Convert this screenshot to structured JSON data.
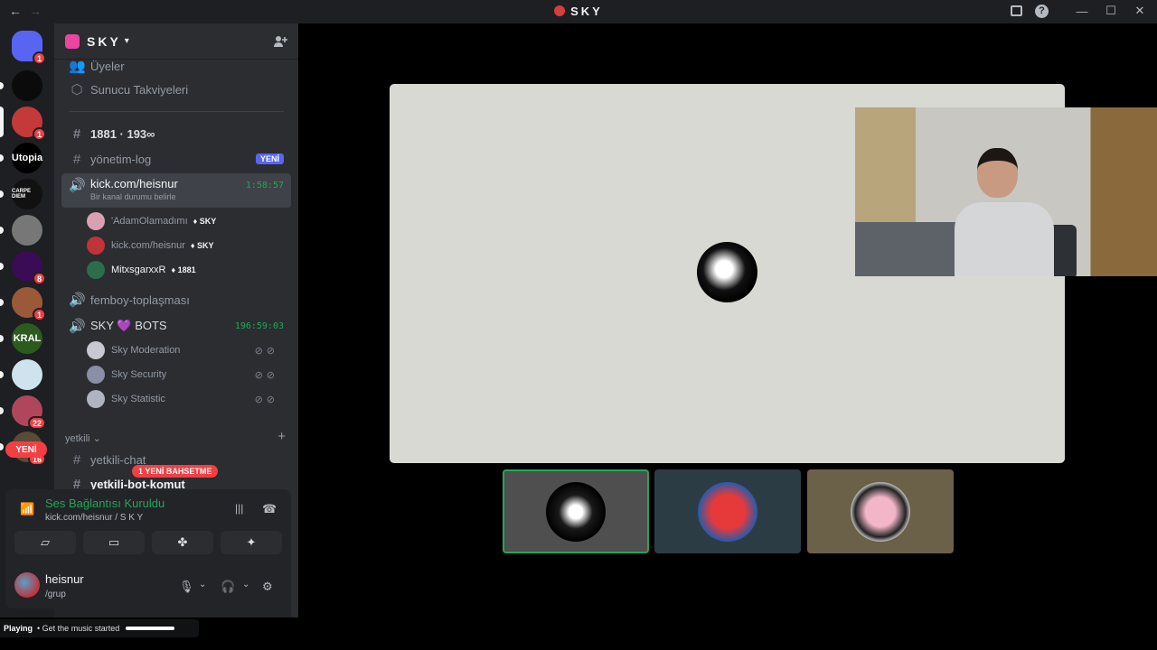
{
  "titlebar": {
    "title": "SKY",
    "back": "←",
    "forward": "→",
    "minimize": "—",
    "maximize": "☐",
    "close": "✕",
    "help": "?"
  },
  "guilds": [
    {
      "label": "",
      "color": "#5865f2",
      "badge": "1"
    },
    {
      "label": "",
      "color": "#0b0b0b",
      "badge": ""
    },
    {
      "label": "",
      "color": "#c43a3a",
      "badge": "1"
    },
    {
      "label": "Utopia",
      "color": "#000000",
      "badge": ""
    },
    {
      "label": "CARPE DIEM",
      "color": "#111111",
      "badge": ""
    },
    {
      "label": "",
      "color": "#777777",
      "badge": ""
    },
    {
      "label": "",
      "color": "#3a0c56",
      "badge": "8"
    },
    {
      "label": "",
      "color": "#9a5a3a",
      "badge": "1"
    },
    {
      "label": "KRAL",
      "color": "#2d5b1f",
      "badge": ""
    },
    {
      "label": "",
      "color": "#cfe3ef",
      "badge": ""
    },
    {
      "label": "",
      "color": "#b0465c",
      "badge": "22"
    },
    {
      "label": "",
      "color": "#5a4a36",
      "badge": "16"
    }
  ],
  "guild_new": "YENİ",
  "server": {
    "name": "SKY"
  },
  "channels": {
    "members": "Üyeler",
    "boosts": "Sunucu Takviyeleri",
    "ch1": "1881 · 193∞",
    "ch2": "yönetim-log",
    "ch2_badge": "YENİ",
    "voice1": {
      "name": "kick.com/heisnur",
      "status": "Bir kanal durumu belirle",
      "timer": "1:58:57"
    },
    "voice1_users": [
      {
        "name": "'AdamOlamadımı",
        "tag": "SKY",
        "color": "#d9a0b4"
      },
      {
        "name": "kick.com/heisnur",
        "tag": "SKY",
        "color": "#c0333b"
      },
      {
        "name": "MitxsgarxxR",
        "tag": "1881",
        "color": "#2e6d4b"
      }
    ],
    "voice2": {
      "name": "femboy-toplaşması"
    },
    "voice3": {
      "name": "SKY 💜 BOTS",
      "timer": "196:59:03"
    },
    "voice3_users": [
      {
        "name": "Sky Moderation",
        "color": "#c8c8d0"
      },
      {
        "name": "Sky Security",
        "color": "#8a8fa8"
      },
      {
        "name": "Sky Statistic",
        "color": "#b0b4c0"
      }
    ],
    "category": "yetkili",
    "ch3": "yetkili-chat",
    "ch4": "yetkili-bot-komut",
    "mention": "1 YENİ BAHSETME"
  },
  "voice_panel": {
    "status": "Ses Bağlantısı Kuruldu",
    "channel": "kick.com/heisnur / S K Y"
  },
  "user": {
    "name": "heisnur",
    "status": "/grup"
  },
  "now_playing": {
    "label": "Playing",
    "text": "Get the music started",
    "progress": 1.0
  },
  "colors": {
    "accent": "#5865f2",
    "green": "#23a55a",
    "red": "#f23f43"
  }
}
